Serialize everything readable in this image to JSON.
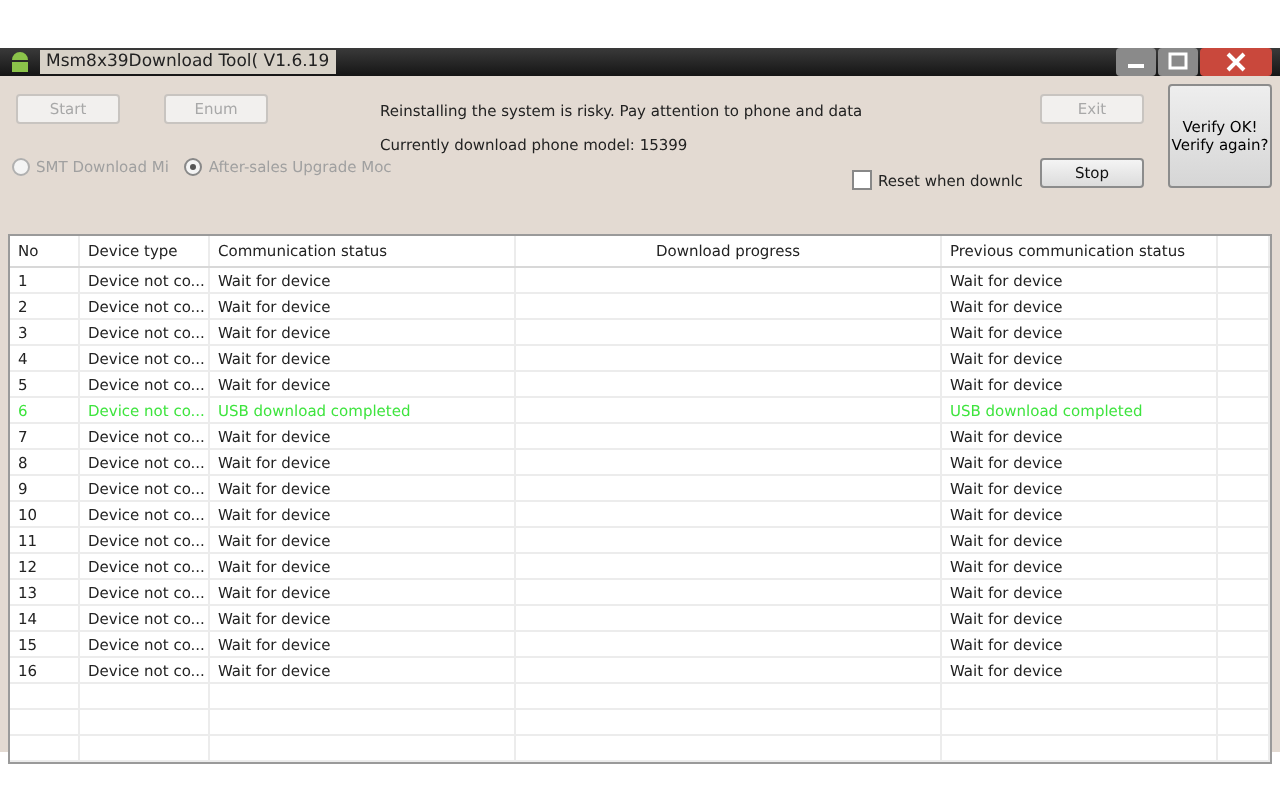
{
  "window": {
    "title": "Msm8x39Download Tool( V1.6.19"
  },
  "buttons": [
    {
      "label": "Start",
      "disabled": true
    },
    {
      "label": "Enum",
      "disabled": true
    }
  ],
  "notice": "Reinstalling the system is risky. Pay attention to phone and data",
  "model": "Currently download phone model: 15399",
  "exit_button": {
    "label": "Exit",
    "disabled": true
  },
  "stop_button": {
    "label": "Stop",
    "disabled": false
  },
  "verify_button": {
    "line_1": "Verify OK!",
    "line_2": "Verify again?"
  },
  "modes": [
    {
      "label": "SMT Download Mi",
      "selected": false,
      "disabled": true
    },
    {
      "label": "After-sales Upgrade Moc",
      "selected": true,
      "disabled": true
    }
  ],
  "reset_checkbox": {
    "label": "Reset when downlc",
    "checked": false
  },
  "table": {
    "columns": [
      "No",
      "Device type",
      "Communication status",
      "Download progress",
      "Previous communication status"
    ],
    "rows": [
      {
        "no": "1",
        "device": "Device not co...",
        "status": "Wait for device",
        "previous": "Wait for device",
        "completed": false
      },
      {
        "no": "2",
        "device": "Device not co...",
        "status": "Wait for device",
        "previous": "Wait for device",
        "completed": false
      },
      {
        "no": "3",
        "device": "Device not co...",
        "status": "Wait for device",
        "previous": "Wait for device",
        "completed": false
      },
      {
        "no": "4",
        "device": "Device not co...",
        "status": "Wait for device",
        "previous": "Wait for device",
        "completed": false
      },
      {
        "no": "5",
        "device": "Device not co...",
        "status": "Wait for device",
        "previous": "Wait for device",
        "completed": false
      },
      {
        "no": "6",
        "device": "Device not co...",
        "status": "USB download completed",
        "previous": "USB download completed",
        "completed": true
      },
      {
        "no": "7",
        "device": "Device not co...",
        "status": "Wait for device",
        "previous": "Wait for device",
        "completed": false
      },
      {
        "no": "8",
        "device": "Device not co...",
        "status": "Wait for device",
        "previous": "Wait for device",
        "completed": false
      },
      {
        "no": "9",
        "device": "Device not co...",
        "status": "Wait for device",
        "previous": "Wait for device",
        "completed": false
      },
      {
        "no": "10",
        "device": "Device not co...",
        "status": "Wait for device",
        "previous": "Wait for device",
        "completed": false
      },
      {
        "no": "11",
        "device": "Device not co...",
        "status": "Wait for device",
        "previous": "Wait for device",
        "completed": false
      },
      {
        "no": "12",
        "device": "Device not co...",
        "status": "Wait for device",
        "previous": "Wait for device",
        "completed": false
      },
      {
        "no": "13",
        "device": "Device not co...",
        "status": "Wait for device",
        "previous": "Wait for device",
        "completed": false
      },
      {
        "no": "14",
        "device": "Device not co...",
        "status": "Wait for device",
        "previous": "Wait for device",
        "completed": false
      },
      {
        "no": "15",
        "device": "Device not co...",
        "status": "Wait for device",
        "previous": "Wait for device",
        "completed": false
      },
      {
        "no": "16",
        "device": "Device not co...",
        "status": "Wait for device",
        "previous": "Wait for device",
        "completed": false
      }
    ]
  }
}
